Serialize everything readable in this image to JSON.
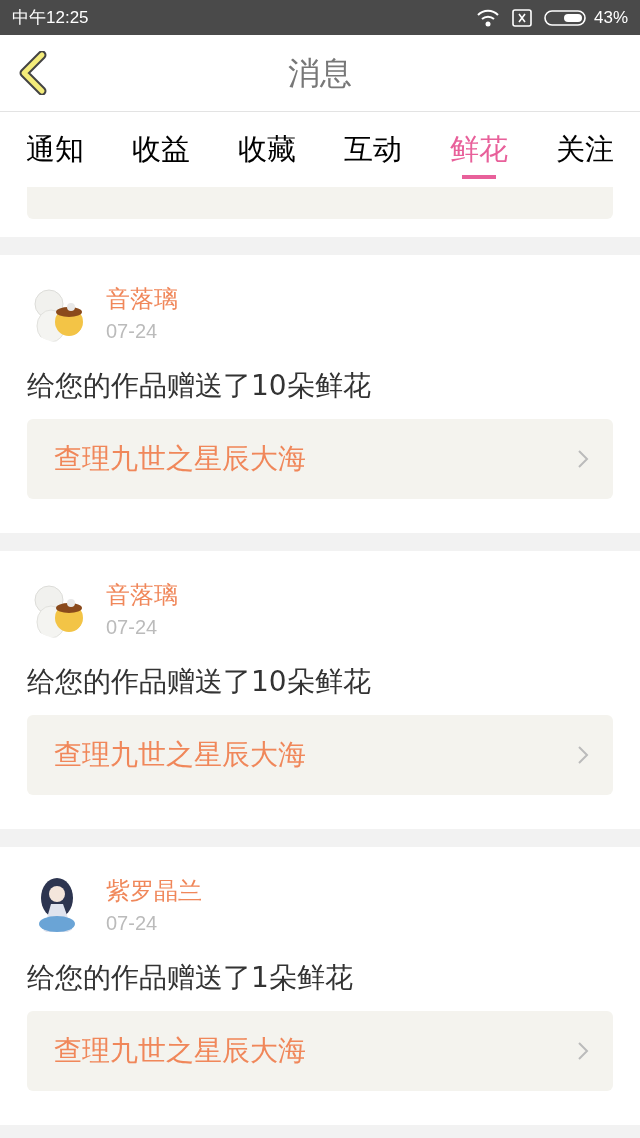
{
  "status_bar": {
    "time": "中午12:25",
    "battery": "43%"
  },
  "header": {
    "title": "消息"
  },
  "tabs": [
    {
      "label": "通知",
      "selected": false
    },
    {
      "label": "收益",
      "selected": false
    },
    {
      "label": "收藏",
      "selected": false
    },
    {
      "label": "互动",
      "selected": false
    },
    {
      "label": "鲜花",
      "selected": true
    },
    {
      "label": "关注",
      "selected": false
    }
  ],
  "messages": [
    {
      "sender": "音落璃",
      "date": "07-24",
      "text": "给您的作品赠送了10朵鲜花",
      "work": "查理九世之星辰大海"
    },
    {
      "sender": "音落璃",
      "date": "07-24",
      "text": "给您的作品赠送了10朵鲜花",
      "work": "查理九世之星辰大海"
    },
    {
      "sender": "紫罗晶兰",
      "date": "07-24",
      "text": "给您的作品赠送了1朵鲜花",
      "work": "查理九世之星辰大海"
    }
  ]
}
